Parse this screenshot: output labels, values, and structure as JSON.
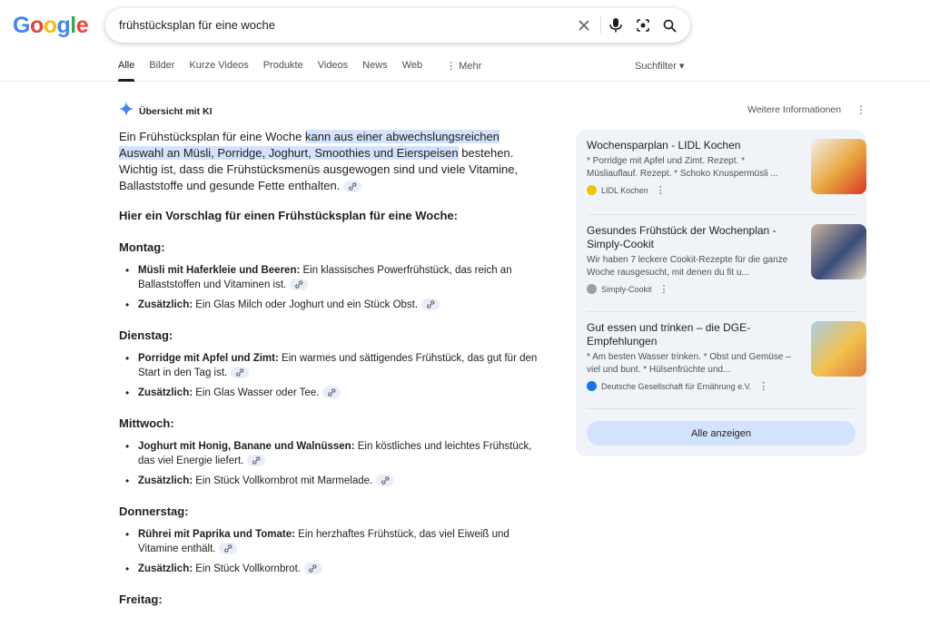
{
  "logo": {
    "letters": [
      "G",
      "o",
      "o",
      "g",
      "l",
      "e"
    ],
    "colors": [
      "#4285f4",
      "#ea4335",
      "#fbbc05",
      "#4285f4",
      "#34a853",
      "#ea4335"
    ]
  },
  "search": {
    "query": "frühstücksplan für eine woche"
  },
  "tabs": [
    "Alle",
    "Bilder",
    "Kurze Videos",
    "Produkte",
    "Videos",
    "News",
    "Web",
    "⋮ Mehr"
  ],
  "suchfilter": "Suchfilter ▾",
  "ai": {
    "title": "Übersicht mit KI",
    "more_info": "Weitere Informationen",
    "intro_before": "Ein Frühstücksplan für eine Woche ",
    "intro_highlight": "kann aus einer abwechslungsreichen Auswahl an Müsli, Porridge, Joghurt, Smoothies und Eierspeisen",
    "intro_after": " bestehen. Wichtig ist, dass die Frühstücksmenüs ausgewogen sind und viele Vitamine, Ballaststoffe und gesunde Fette enthalten.",
    "subhead": "Hier ein Vorschlag für einen Frühstücksplan für eine Woche:",
    "days": [
      {
        "name": "Montag:",
        "items": [
          {
            "bold": "Müsli mit Haferkleie und Beeren:",
            "text": " Ein klassisches Powerfrühstück, das reich an Ballaststoffen und Vitaminen ist."
          },
          {
            "bold": "Zusätzlich:",
            "text": " Ein Glas Milch oder Joghurt und ein Stück Obst."
          }
        ]
      },
      {
        "name": "Dienstag:",
        "items": [
          {
            "bold": "Porridge mit Apfel und Zimt:",
            "text": " Ein warmes und sättigendes Frühstück, das gut für den Start in den Tag ist."
          },
          {
            "bold": "Zusätzlich:",
            "text": " Ein Glas Wasser oder Tee."
          }
        ]
      },
      {
        "name": "Mittwoch:",
        "items": [
          {
            "bold": "Joghurt mit Honig, Banane und Walnüssen:",
            "text": " Ein köstliches und leichtes Frühstück, das viel Energie liefert."
          },
          {
            "bold": "Zusätzlich:",
            "text": " Ein Stück Vollkornbrot mit Marmelade."
          }
        ]
      },
      {
        "name": "Donnerstag:",
        "items": [
          {
            "bold": "Rührei mit Paprika und Tomate:",
            "text": " Ein herzhaftes Frühstück, das viel Eiweiß und Vitamine enthält."
          },
          {
            "bold": "Zusätzlich:",
            "text": " Ein Stück Vollkornbrot."
          }
        ]
      },
      {
        "name": "Freitag:",
        "items": []
      }
    ]
  },
  "sources": [
    {
      "title": "Wochensparplan - LIDL Kochen",
      "snippet": "* Porridge mit Apfel und Zimt. Rezept. * Müsliauflauf. Rezept. * Schoko Knuspermüsli ...",
      "site": "LIDL Kochen",
      "fav_color": "#f5c400",
      "thumb": [
        "#f2f0ea",
        "#e8a53a",
        "#d9342b"
      ]
    },
    {
      "title": "Gesundes Frühstück der Wochenplan - Simply-Cookit",
      "snippet": "Wir haben 7 leckere Cookit-Rezepte für die ganze Woche rausgesucht, mit denen du fit u...",
      "site": "Simply-Cookit",
      "fav_color": "#9aa0a6",
      "thumb": [
        "#c9b79c",
        "#3b4a7a",
        "#e9d8b8"
      ]
    },
    {
      "title": "Gut essen und trinken – die DGE-Empfehlungen",
      "snippet": "* Am besten Wasser trinken. * Obst und Gemüse – viel und bunt. * Hülsenfrüchte und...",
      "site": "Deutsche Gesellschaft für Ernährung e.V.",
      "fav_color": "#1a73e8",
      "thumb": [
        "#a8cfe6",
        "#f2c14e",
        "#e07a3f"
      ]
    }
  ],
  "all_button": "Alle anzeigen"
}
